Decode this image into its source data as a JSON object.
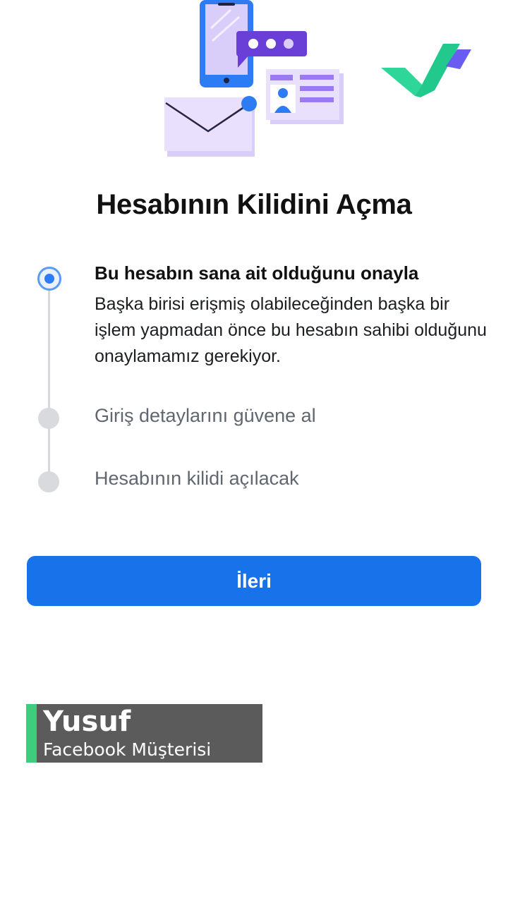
{
  "header": {
    "illustration_icon": "account-verification-illustration",
    "brand_logo_icon": "checkmark-logo-icon"
  },
  "page": {
    "title": "Hesabının Kilidini Açma"
  },
  "steps": [
    {
      "status": "active",
      "title": "Bu hesabın sana ait olduğunu onayla",
      "description": "Başka birisi erişmiş olabileceğinden başka bir işlem yapmadan önce bu hesabın sahibi olduğunu onaylamamız gerekiyor."
    },
    {
      "status": "pending",
      "title": "Giriş detaylarını güvene al"
    },
    {
      "status": "pending",
      "title": "Hesabının kilidi açılacak"
    }
  ],
  "actions": {
    "next_label": "İleri"
  },
  "caption": {
    "name": "Yusuf",
    "role": "Facebook Müşterisi"
  },
  "colors": {
    "primary_button": "#1873eb",
    "active_step": "#2d7cf4",
    "pending_step": "#d8dadd",
    "caption_accent": "#3ecc7d",
    "brand_green": "#2fd69a",
    "brand_purple": "#6a5cf0"
  }
}
